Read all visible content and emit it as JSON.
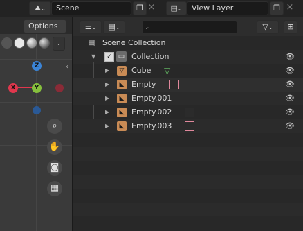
{
  "topbar": {
    "scene_label": "Scene",
    "view_layer_label": "View Layer"
  },
  "viewport": {
    "options_label": "Options",
    "gizmo": {
      "z": "Z",
      "y": "Y",
      "x": "X"
    }
  },
  "outliner": {
    "root_label": "Scene Collection",
    "collection_label": "Collection",
    "items": [
      {
        "label": "Cube",
        "type": "mesh"
      },
      {
        "label": "Empty",
        "type": "empty"
      },
      {
        "label": "Empty.001",
        "type": "empty"
      },
      {
        "label": "Empty.002",
        "type": "empty"
      },
      {
        "label": "Empty.003",
        "type": "empty"
      }
    ]
  },
  "colors": {
    "accent_orange": "#c98b55",
    "empty_pink": "#e0889c",
    "mesh_green": "#6bc96b",
    "axis_x": "#e0374d",
    "axis_y": "#86c03d",
    "axis_z": "#3b84d6"
  },
  "icons": [
    "scene-icon",
    "chevron-down-icon",
    "copy-icon",
    "close-icon",
    "view-layer-icon",
    "search-icon",
    "filter-icon",
    "new-collection-icon",
    "eye-icon",
    "hand-icon",
    "camera-icon",
    "grid-icon",
    "zoom-icon"
  ]
}
